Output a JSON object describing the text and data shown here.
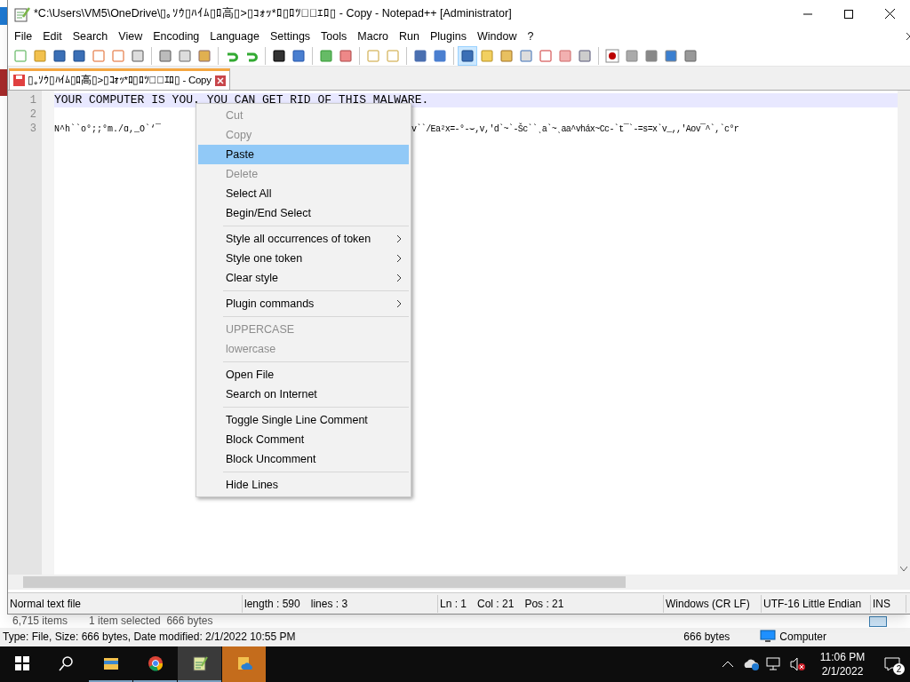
{
  "window": {
    "title": "*C:\\Users\\VM5\\OneDrive\\▯｡ｿｳ▯ﾊｲﾑ▯ﾛ高▯>▯ｺｫｯ*ﾛ▯ﾛﾂ▯ﾟｴﾛ▯ - Copy - Notepad++ [Administrator]"
  },
  "menu": [
    "File",
    "Edit",
    "Search",
    "View",
    "Encoding",
    "Language",
    "Settings",
    "Tools",
    "Macro",
    "Run",
    "Plugins",
    "Window",
    "?"
  ],
  "toolbar": [
    {
      "pressed": false
    },
    {
      "pressed": false
    },
    {
      "pressed": false
    },
    {
      "pressed": false
    },
    {
      "pressed": false
    },
    {
      "pressed": false
    },
    {
      "pressed": false
    },
    {
      "pressed": false
    },
    {
      "pressed": false
    },
    {
      "pressed": false
    },
    {
      "pressed": false
    },
    {
      "pressed": false
    },
    {
      "pressed": false
    },
    {
      "pressed": false
    },
    {
      "pressed": false
    },
    {
      "pressed": false
    },
    {
      "pressed": false
    },
    {
      "pressed": false
    },
    {
      "pressed": false
    },
    {
      "pressed": false
    },
    {
      "pressed": true
    },
    {
      "pressed": false
    },
    {
      "pressed": false
    },
    {
      "pressed": false
    },
    {
      "pressed": false
    },
    {
      "pressed": false
    },
    {
      "pressed": false
    },
    {
      "pressed": false
    },
    {
      "pressed": false
    },
    {
      "pressed": false
    },
    {
      "pressed": false
    },
    {
      "pressed": false
    }
  ],
  "tabs": [
    {
      "label": "▯｡ｿｳ▯ﾊｲﾑ▯ﾛ高▯>▯ｺｫｯ*ﾛ▯ﾛﾂ▯ﾟｴﾛ▯ - Copy",
      "selected": true,
      "modified": true
    }
  ],
  "editor": {
    "lines": [
      {
        "number": "1",
        "current": true,
        "parts": [
          "YOUR COMPUTER IS YOU. YOU CAN GET RID OF THIS MALWARE."
        ]
      },
      {
        "number": "2",
        "current": false
      },
      {
        "number": "3",
        "current": false,
        "parts": [
          "N^h``o°;;°m./ɑ,_O`‘¯",
          "v``/Ea²x=-°-⌣,v,'d`~`-Šc``ˎa`~ˎaa^vháx~Cc-`t¯`-=s=x`v_,,'Aov¯^`,`c°r"
        ]
      }
    ]
  },
  "context_menu": [
    {
      "kind": "item",
      "label": "Cut",
      "disabled": true,
      "highlighted": false,
      "submenu": false
    },
    {
      "kind": "item",
      "label": "Copy",
      "disabled": true,
      "highlighted": false,
      "submenu": false
    },
    {
      "kind": "item",
      "label": "Paste",
      "disabled": false,
      "highlighted": true,
      "submenu": false
    },
    {
      "kind": "item",
      "label": "Delete",
      "disabled": true,
      "highlighted": false,
      "submenu": false
    },
    {
      "kind": "item",
      "label": "Select All",
      "disabled": false,
      "highlighted": false,
      "submenu": false
    },
    {
      "kind": "item",
      "label": "Begin/End Select",
      "disabled": false,
      "highlighted": false,
      "submenu": false
    },
    {
      "kind": "separator"
    },
    {
      "kind": "item",
      "label": "Style all occurrences of token",
      "disabled": false,
      "highlighted": false,
      "submenu": true
    },
    {
      "kind": "item",
      "label": "Style one token",
      "disabled": false,
      "highlighted": false,
      "submenu": true
    },
    {
      "kind": "item",
      "label": "Clear style",
      "disabled": false,
      "highlighted": false,
      "submenu": true
    },
    {
      "kind": "separator"
    },
    {
      "kind": "item",
      "label": "Plugin commands",
      "disabled": false,
      "highlighted": false,
      "submenu": true
    },
    {
      "kind": "separator"
    },
    {
      "kind": "item",
      "label": "UPPERCASE",
      "disabled": true,
      "highlighted": false,
      "submenu": false
    },
    {
      "kind": "item",
      "label": "lowercase",
      "disabled": true,
      "highlighted": false,
      "submenu": false
    },
    {
      "kind": "separator"
    },
    {
      "kind": "item",
      "label": "Open File",
      "disabled": false,
      "highlighted": false,
      "submenu": false
    },
    {
      "kind": "item",
      "label": "Search on Internet",
      "disabled": false,
      "highlighted": false,
      "submenu": false
    },
    {
      "kind": "separator"
    },
    {
      "kind": "item",
      "label": "Toggle Single Line Comment",
      "disabled": false,
      "highlighted": false,
      "submenu": false
    },
    {
      "kind": "item",
      "label": "Block Comment",
      "disabled": false,
      "highlighted": false,
      "submenu": false
    },
    {
      "kind": "item",
      "label": "Block Uncomment",
      "disabled": false,
      "highlighted": false,
      "submenu": false
    },
    {
      "kind": "separator"
    },
    {
      "kind": "item",
      "label": "Hide Lines",
      "disabled": false,
      "highlighted": false,
      "submenu": false
    }
  ],
  "status_bar": [
    [
      "Normal text file"
    ],
    [
      "length : 590",
      "lines : 3"
    ],
    [
      "Ln : 1",
      "Col : 21",
      "Pos : 21"
    ],
    [
      "Windows (CR LF)"
    ],
    [
      "UTF-16 Little Endian"
    ],
    [
      "INS"
    ]
  ],
  "background_window": {
    "item_count": "6,715 items",
    "selection": "1 item selected  666 bytes",
    "details": "Type: File, Size: 666 bytes, Date modified: 2/1/2022 10:55 PM",
    "size": "666 bytes",
    "location": "Computer"
  },
  "taskbar": {
    "apps": [
      {
        "kind": "start",
        "running": false,
        "active": false,
        "flashing": false
      },
      {
        "kind": "search",
        "running": false,
        "active": false,
        "flashing": false
      },
      {
        "kind": "explorer",
        "running": true,
        "active": false,
        "flashing": false
      },
      {
        "kind": "chrome",
        "running": true,
        "active": false,
        "flashing": false
      },
      {
        "kind": "notepad",
        "running": true,
        "active": true,
        "flashing": false
      },
      {
        "kind": "onedrive-folder",
        "running": false,
        "active": false,
        "flashing": true
      }
    ],
    "time": "11:06 PM",
    "date": "2/1/2022",
    "notifications": "2"
  }
}
